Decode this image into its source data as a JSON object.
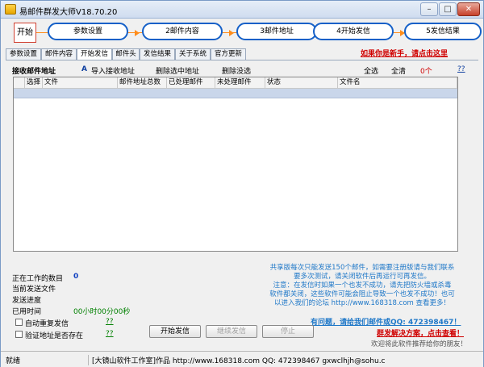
{
  "window": {
    "title": "易邮件群发大师V18.70.20",
    "minimize": "–",
    "maximize": "□",
    "close": "✕"
  },
  "steps": {
    "start": "开始",
    "items": [
      "参数设置",
      "2邮件内容",
      "3邮件地址",
      "4开始发信",
      "5发信结果"
    ]
  },
  "tabs": [
    "参数设置",
    "邮件内容",
    "开始发信",
    "邮件头",
    "发信结果",
    "关于系统",
    "官方更新"
  ],
  "active_tab": "开始发信",
  "newbie_link": "如果你是新手，请点击这里",
  "toolbar": {
    "receive_address": "接收邮件地址",
    "import": "导入接收地址",
    "delete_selected": "删除选中地址",
    "delete_unselected": "删除没选",
    "select_all": "全选",
    "clear_all": "全清",
    "count": "0个",
    "help": "??"
  },
  "grid": {
    "columns": [
      "选择",
      "文件",
      "邮件地址总数",
      "已处理邮件",
      "未处理邮件",
      "状态",
      "文件名"
    ]
  },
  "status": {
    "working_count_label": "正在工作的数目",
    "working_count": "0",
    "current_file_label": "当前发送文件",
    "progress_label": "发送进度",
    "elapsed_label": "已用时间",
    "elapsed": "00小时00分00秒",
    "auto_resend": "自动重复发信",
    "verify_address": "验证地址是否存在",
    "help": "??"
  },
  "notice": {
    "line1": "共享版每次只能发送150个邮件，如需要注册版请与我们联系",
    "line2": "要多次测试，请关闭软件后再运行可再发信。",
    "line3": "注意：在发信时如果一个也发不成功，请先把防火墙或杀毒",
    "line4": "软件都关闭，这些软件可能会阻止导致一个也发不成功！也可",
    "line5": "以进入我们的论坛 http://www.168318.com 查看更多！"
  },
  "buttons": {
    "start": "开始发信",
    "continue": "继续发信",
    "stop": "停止"
  },
  "contact": {
    "question": "有问题，请给我们邮件或QQ: 472398467！",
    "solution": "群发解决方案，点击查看！",
    "recommend": "欢迎将此软件推荐给你的朋友！"
  },
  "statusbar": {
    "ready": "就绪",
    "author": "[大镜山软件工作室]作品 http://www.168318.com QQ: 472398467 gxwclhjh@sohu.c"
  },
  "colors": {
    "accent_blue": "#1560c8",
    "link_red": "#d00000",
    "count_red": "#d00000",
    "step_orange": "#ff8c1a",
    "notice_blue": "#1f78c8",
    "elapsed_green": "#008000",
    "selection": "#c9d6ea"
  }
}
